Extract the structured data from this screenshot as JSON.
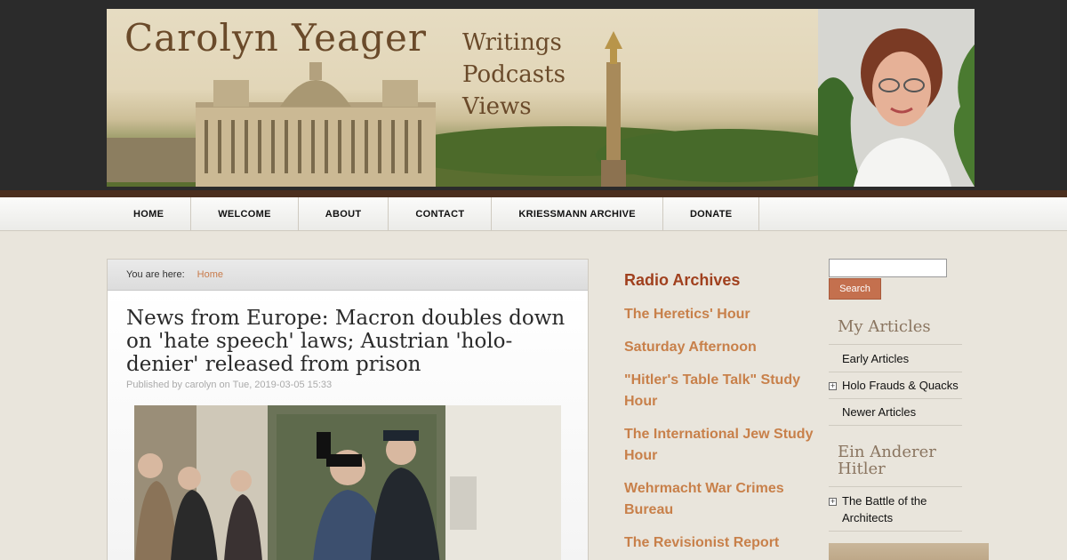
{
  "header": {
    "site_title": "Carolyn Yeager",
    "tagline": [
      "Writings",
      "Podcasts",
      "Views"
    ]
  },
  "nav": {
    "items": [
      "HOME",
      "WELCOME",
      "ABOUT",
      "CONTACT",
      "KRIESSMANN ARCHIVE",
      "DONATE"
    ]
  },
  "breadcrumb": {
    "label": "You are here:",
    "home": "Home"
  },
  "article": {
    "title": "News from Europe: Macron doubles down on 'hate speech' laws; Austrian 'holo-denier' released from prison",
    "byline": "Published by carolyn on Tue, 2019-03-05 15:33"
  },
  "radio": {
    "heading": "Radio Archives",
    "links": [
      "The Heretics' Hour",
      "Saturday Afternoon",
      "\"Hitler's Table Talk\" Study Hour",
      "The International Jew Study Hour",
      "Wehrmacht War Crimes Bureau",
      "The Revisionist Report"
    ]
  },
  "sidebar": {
    "search_value": "",
    "search_button": "Search",
    "my_articles_heading": "My Articles",
    "my_articles": [
      "Early Articles",
      "Holo Frauds & Quacks",
      "Newer Articles"
    ],
    "ein_anderer_heading": "Ein Anderer Hitler",
    "ein_anderer_items": [
      "The Battle of the Architects"
    ]
  },
  "colors": {
    "accent": "#c8804a",
    "heading_red": "#a0401e",
    "header_bg": "#2b2b2b",
    "brown_rule": "#4a2e1e"
  }
}
